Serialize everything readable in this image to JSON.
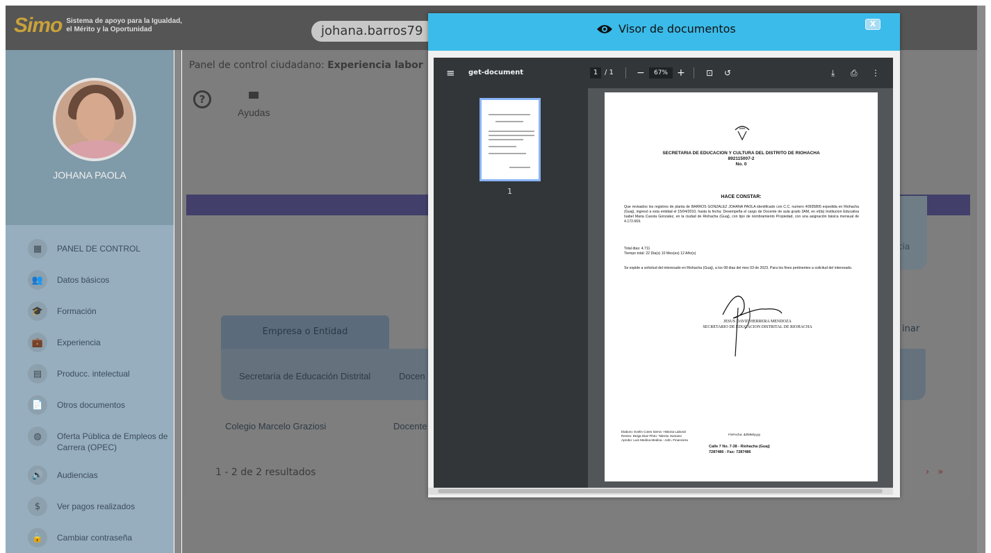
{
  "app": {
    "logo": "Simo",
    "logo_subtitle_1": "Sistema de apoyo para la Igualdad,",
    "logo_subtitle_2": "el Mérito y la Oportunidad",
    "username": "johana.barros79"
  },
  "profile": {
    "name": "JOHANA PAOLA"
  },
  "sidebar": {
    "items": [
      {
        "label": "PANEL DE CONTROL",
        "icon": "dashboard-icon",
        "glyph": "▦"
      },
      {
        "label": "Datos básicos",
        "icon": "people-icon",
        "glyph": "👥"
      },
      {
        "label": "Formación",
        "icon": "education-icon",
        "glyph": "🎓"
      },
      {
        "label": "Experiencia",
        "icon": "briefcase-icon",
        "glyph": "💼"
      },
      {
        "label": "Producc. intelectual",
        "icon": "book-icon",
        "glyph": "▤"
      },
      {
        "label": "Otros documentos",
        "icon": "document-icon",
        "glyph": "📄"
      },
      {
        "label": "Oferta Pública de Empleos de Carrera (OPEC)",
        "icon": "globe-icon",
        "glyph": "◍"
      },
      {
        "label": "Audiencias",
        "icon": "audience-icon",
        "glyph": "🔊"
      },
      {
        "label": "Ver pagos realizados",
        "icon": "dollar-icon",
        "glyph": "$"
      },
      {
        "label": "Cambiar contraseña",
        "icon": "lock-icon",
        "glyph": "🔒"
      }
    ]
  },
  "main": {
    "breadcrumb_prefix": "Panel de control ciudadano: ",
    "breadcrumb_section": "Experiencia labor",
    "ayudas": "Ayudas",
    "right_card_text": "cia",
    "table": {
      "headers": [
        "Empresa o Entidad"
      ],
      "eliminar": "inar",
      "rows": [
        {
          "empresa": "Secretaría de Educación Distrital",
          "cargo": "Docen"
        },
        {
          "empresa": "Colegio Marcelo Graziosi",
          "cargo": "Docente"
        }
      ]
    },
    "results": "1 - 2 de 2 resultados",
    "pager": "› »"
  },
  "modal": {
    "title": "Visor de documentos",
    "close": "X",
    "pdf": {
      "doc_name": "get-document",
      "page_current": "1",
      "page_total": "/ 1",
      "zoom": "67%",
      "thumb_label": "1",
      "header": "SECRETARIA DE EDUCACION Y CULTURA DEL DISTRITO DE RIOHACHA",
      "nit": "892115007-2",
      "number": "No. 0",
      "hace_constar": "HACE CONSTAR:",
      "paragraph1": "Que revisados los registros de planta de BARROS GONZALEZ JOHANA PAOLA identificado con C.C. numero 40935805 expedida en Riohacha (Guaj), ingresó a esta entidad el 15/04/2010, hasta la fecha: Desempeña el cargo de Docente de aula grado 3AM, en el(la) Institucion Educativa Isabel Maria Cuesta Gonzalez, en la ciudad de Riohacha (Guaj), con tipo de nombramiento Propiedad, con una asignación básica mensual de 4.172.669.",
      "total_dias": "Total dias: 4.711",
      "tiempo_total": "Tiempo total: 22 Dia(s) 10 Mes(es) 12 Año(s)",
      "paragraph2": "Se expide a solicitud del interesado en Riohacha (Guaj), a los 08 dias del mes 03 de 2023. Para los fines pertinentes a solicitud del interesado.",
      "signer_name": "JESUS DAVID HERRERA MENDOZA",
      "signer_title": "SECRETARIO DE EDUCACION DISTRITAL DE RIOHACHA",
      "elaboro": "Elaboro: Evelin Cotes Sierra- Historia Laboral",
      "reviso": "Reviso: Deiga Diaz Pinto- Talento Humano",
      "aprobo": "Aprobo: Luis Medina Medina - Adm. Financiera",
      "fecha": "FinFecha: dd/MM/yyyy",
      "address": "Calle 7 No. 7-38 - Riohacha (Guaj)",
      "phones": "7287486 - Fax: 7287486"
    }
  },
  "colors": {
    "modal_header": "#3bbbe9",
    "pdf_toolbar": "#323639",
    "overlay": "#7d7d7d"
  }
}
